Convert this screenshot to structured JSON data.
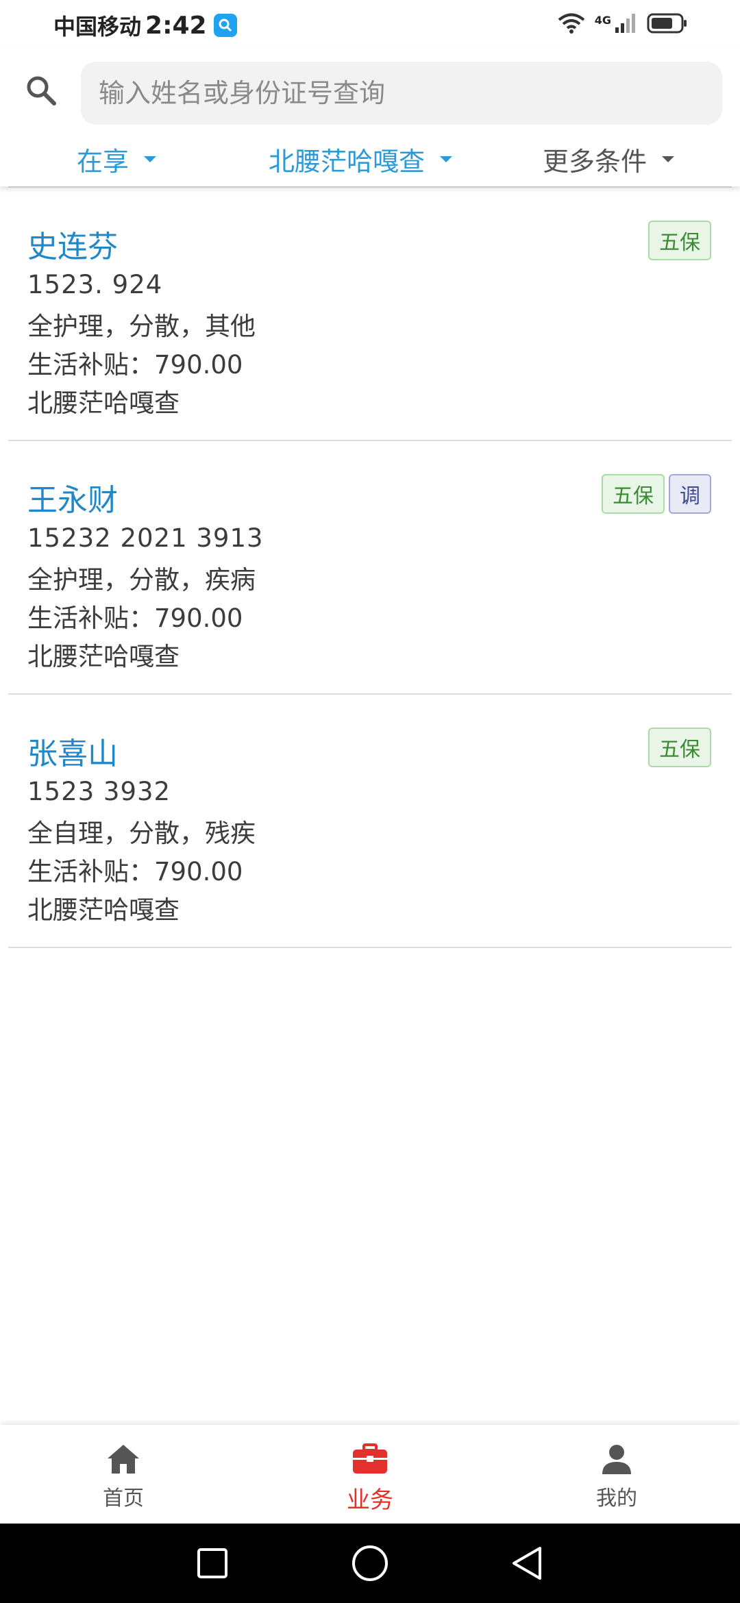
{
  "status_bar": {
    "carrier": "中国移动",
    "time": "2:42",
    "network": "4G",
    "icons": [
      "app-notification-icon",
      "wifi-icon",
      "signal-icon",
      "battery-icon"
    ]
  },
  "search": {
    "placeholder": "输入姓名或身份证号查询",
    "value": ""
  },
  "filters": {
    "status": "在享",
    "region": "北腰茫哈嘎查",
    "more": "更多条件"
  },
  "records": [
    {
      "name": "史连芬",
      "id_number": "1523.                          924",
      "care": "全护理，分散，其他",
      "subsidy": "生活补贴：790.00",
      "area": "北腰茫哈嘎查",
      "tags": [
        "五保"
      ]
    },
    {
      "name": "王永财",
      "id_number": "15232        2021 3913",
      "care": "全护理，分散，疾病",
      "subsidy": "生活补贴：790.00",
      "area": "北腰茫哈嘎查",
      "tags": [
        "五保",
        "调"
      ]
    },
    {
      "name": "张喜山",
      "id_number": "1523                          3932",
      "care": "全自理，分散，残疾",
      "subsidy": "生活补贴：790.00",
      "area": "北腰茫哈嘎查",
      "tags": [
        "五保"
      ]
    }
  ],
  "tabbar": {
    "home": "首页",
    "business": "业务",
    "mine": "我的",
    "active": "业务"
  },
  "colors": {
    "name_blue": "#2187c7",
    "filter_blue": "#2b9ad6",
    "active_red": "#e2312c",
    "tag_green": "#3a8a33",
    "tag_indigo": "#3f4a91"
  }
}
